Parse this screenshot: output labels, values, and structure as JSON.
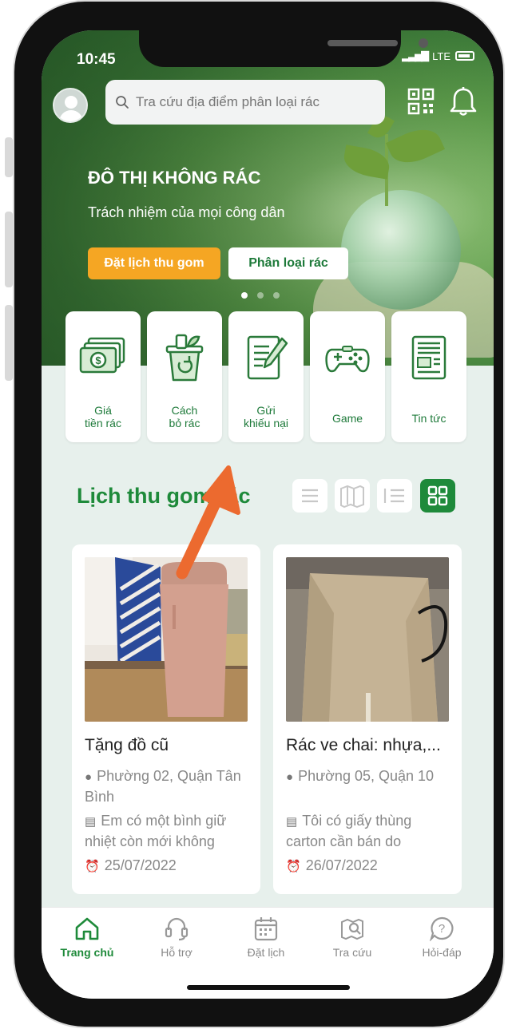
{
  "status": {
    "time": "10:45",
    "network": "LTE"
  },
  "search": {
    "placeholder": "Tra cứu địa điểm phân loại rác"
  },
  "banner": {
    "title": "ĐÔ THỊ KHÔNG RÁC",
    "subtitle": "Trách nhiệm của mọi công dân",
    "primary_button": "Đặt lịch thu gom",
    "secondary_button": "Phân loại rác",
    "slides": 3,
    "active_slide": 1
  },
  "quick_actions": [
    {
      "line1": "Giá",
      "line2": "tiền rác",
      "icon": "money-icon"
    },
    {
      "line1": "Cách",
      "line2": "bỏ rác",
      "icon": "recycle-bin-icon"
    },
    {
      "line1": "Gửi",
      "line2": "khiếu nại",
      "icon": "complaint-form-icon"
    },
    {
      "line1": "Game",
      "line2": "",
      "icon": "gamepad-icon"
    },
    {
      "line1": "Tin tức",
      "line2": "",
      "icon": "newspaper-icon"
    }
  ],
  "section": {
    "title": "Lịch thu gom rác",
    "view_modes": [
      "list-view-icon",
      "map-view-icon",
      "numbered-list-icon",
      "grid-view-icon"
    ],
    "active_view": "grid-view-icon"
  },
  "cards": [
    {
      "title": "Tặng đồ cũ",
      "location": "Phường 02, Quận Tân Bình",
      "description": "Em có một bình giữ nhiệt còn mới không",
      "date": "25/07/2022"
    },
    {
      "title": "Rác ve chai: nhựa,...",
      "location": "Phường 05, Quận 10",
      "description": "Tôi có giấy thùng carton cần bán do",
      "date": "26/07/2022"
    }
  ],
  "tabs": [
    {
      "label": "Trang chủ",
      "icon": "home-icon",
      "active": true
    },
    {
      "label": "Hỗ trợ",
      "icon": "headset-icon",
      "active": false
    },
    {
      "label": "Đặt lịch",
      "icon": "calendar-icon",
      "active": false
    },
    {
      "label": "Tra cứu",
      "icon": "map-search-icon",
      "active": false
    },
    {
      "label": "Hỏi-đáp",
      "icon": "question-icon",
      "active": false
    }
  ],
  "colors": {
    "brand_green": "#1e8a3a",
    "accent_orange": "#f5a623",
    "annotation_arrow": "#ec6a2f"
  }
}
